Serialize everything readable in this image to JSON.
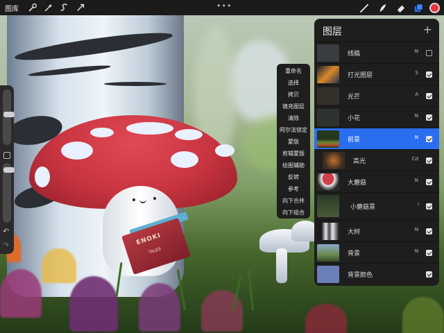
{
  "topbar": {
    "gallery_label": "图库",
    "more_label": "•••",
    "left_tools": [
      "wrench-icon",
      "magic-wand-icon",
      "selection-icon",
      "transform-icon"
    ],
    "right_tools": [
      "brush-icon",
      "smudge-icon",
      "eraser-icon",
      "layers-icon"
    ],
    "color": "#e8323c"
  },
  "artwork": {
    "book_title": "ENOKI",
    "book_subtitle": "TALES"
  },
  "context_menu": {
    "items": [
      "重命名",
      "选择",
      "拷贝",
      "填充图层",
      "清除",
      "阿尔法锁定",
      "蒙版",
      "剪辑蒙版",
      "绘图辅助",
      "反转",
      "参考",
      "向下合并",
      "向下组合"
    ]
  },
  "layers_panel": {
    "title": "图层",
    "add_label": "+",
    "layers": [
      {
        "name": "线稿",
        "blend": "N",
        "visible": false,
        "active": false
      },
      {
        "name": "打光图层",
        "blend": "S",
        "visible": true,
        "active": false
      },
      {
        "name": "光芒",
        "blend": "A",
        "visible": true,
        "active": false
      },
      {
        "name": "小花",
        "blend": "N",
        "visible": true,
        "active": false
      },
      {
        "name": "前景",
        "blend": "N",
        "visible": true,
        "active": true
      },
      {
        "name": "高光",
        "blend": "Cd",
        "visible": true,
        "active": false
      },
      {
        "name": "大蘑菇",
        "blend": "N",
        "visible": true,
        "active": false
      },
      {
        "name": "小蘑菇景",
        "blend": "",
        "visible": true,
        "active": false,
        "group": true
      },
      {
        "name": "大树",
        "blend": "N",
        "visible": true,
        "active": false
      },
      {
        "name": "背景",
        "blend": "N",
        "visible": true,
        "active": false
      },
      {
        "name": "背景颜色",
        "blend": "",
        "visible": true,
        "active": false
      }
    ],
    "accent_color": "#2a6ef0"
  }
}
